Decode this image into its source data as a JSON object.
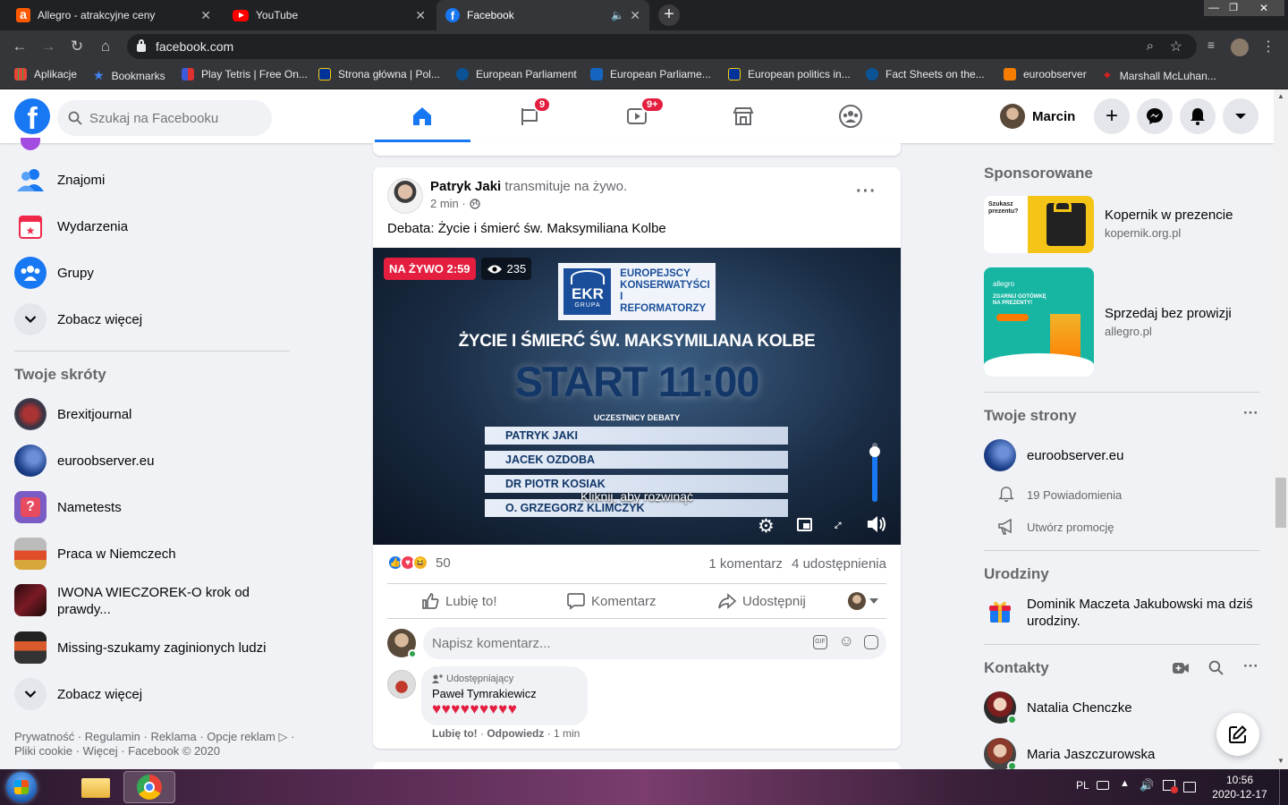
{
  "browser": {
    "tabs": [
      {
        "title": "Allegro - atrakcyjne ceny",
        "icon": "allegro-icon"
      },
      {
        "title": "YouTube",
        "icon": "youtube-icon"
      },
      {
        "title": "Facebook",
        "icon": "facebook-icon"
      }
    ],
    "url": "facebook.com",
    "bookmarks": [
      {
        "label": "Aplikacje",
        "icon": "apps-grid-icon"
      },
      {
        "label": "Bookmarks",
        "icon": "star-icon"
      },
      {
        "label": "Play Tetris | Free On...",
        "icon": "tetris-icon"
      },
      {
        "label": "Strona główna | Pol...",
        "icon": "eu-flag-icon"
      },
      {
        "label": "European Parliament",
        "icon": "eu-parliament-icon"
      },
      {
        "label": "European Parliame...",
        "icon": "eu-parliament-icon"
      },
      {
        "label": "European politics in...",
        "icon": "eu-flag-icon"
      },
      {
        "label": "Fact Sheets on the...",
        "icon": "eu-parliament-icon"
      },
      {
        "label": "euroobserver",
        "icon": "blogger-icon"
      },
      {
        "label": "Marshall McLuhan...",
        "icon": "maple-leaf-icon"
      }
    ]
  },
  "header": {
    "search_placeholder": "Szukaj na Facebooku",
    "badges": {
      "watch": "9",
      "video": "9+"
    },
    "user_name": "Marcin"
  },
  "left": {
    "items": [
      {
        "label": "Znajomi"
      },
      {
        "label": "Wydarzenia"
      },
      {
        "label": "Grupy"
      },
      {
        "label": "Zobacz więcej"
      }
    ],
    "shortcuts_title": "Twoje skróty",
    "shortcuts": [
      {
        "label": "Brexitjournal"
      },
      {
        "label": "euroobserver.eu"
      },
      {
        "label": "Nametests"
      },
      {
        "label": "Praca w Niemczech"
      },
      {
        "label": "IWONA WIECZOREK-O krok od prawdy..."
      },
      {
        "label": "Missing-szukamy zaginionych ludzi"
      },
      {
        "label": "Zobacz więcej"
      }
    ],
    "footer_line1": "Prywatność · Regulamin · Reklama · Opcje reklam ▷ ·",
    "footer_line2": "Pliki cookie · Więcej · Facebook © 2020"
  },
  "post": {
    "author": "Patryk Jaki",
    "action": "transmituje na żywo.",
    "time": "2 min ·",
    "text": "Debata: Życie i śmierć św. Maksymiliana Kolbe",
    "video": {
      "live_label": "NA ŻYWO 2:59",
      "viewers": "235",
      "logo_mark": "EKR",
      "logo_sub": "GRUPA",
      "logo_lines": [
        "EUROPEJSCY",
        "KONSERWATYŚCI",
        "I REFORMATORZY"
      ],
      "headline": "ŻYCIE I ŚMIERĆ ŚW. MAKSYMILIANA KOLBE",
      "start": "START 11:00",
      "participants_label": "UCZESTNICY DEBATY",
      "participants": [
        "PATRYK JAKI",
        "JACEK OZDOBA",
        "DR PIOTR KOSIAK",
        "O. GRZEGORZ KLIMCZYK"
      ],
      "expand_hint": "Kliknij, aby rozwinąć",
      "volume": 0.85
    },
    "reactions_count": "50",
    "comments_count": "1 komentarz",
    "shares_count": "4 udostępnienia",
    "actions": {
      "like": "Lubię to!",
      "comment": "Komentarz",
      "share": "Udostępnij"
    },
    "comment_placeholder": "Napisz komentarz...",
    "comment": {
      "role": "Udostępniający",
      "author": "Paweł Tymrakiewicz",
      "text": "♥♥♥♥♥♥♥♥♥",
      "like": "Lubię to!",
      "reply": "Odpowiedz",
      "time": "1 min"
    }
  },
  "right": {
    "sponsored_title": "Sponsorowane",
    "ads": [
      {
        "title": "Kopernik w prezencie",
        "domain": "kopernik.org.pl"
      },
      {
        "title": "Sprzedaj bez prowizji",
        "domain": "allegro.pl"
      }
    ],
    "pages_title": "Twoje strony",
    "page_name": "euroobserver.eu",
    "notifications": "19 Powiadomienia",
    "promote": "Utwórz promocję",
    "birthdays_title": "Urodziny",
    "birthday_name": "Dominik Maczeta Jakubowski",
    "birthday_text": "ma dziś urodziny.",
    "contacts_title": "Kontakty",
    "contacts": [
      {
        "name": "Natalia Chenczke"
      },
      {
        "name": "Maria Jaszczurowska"
      }
    ]
  },
  "taskbar": {
    "lang": "PL",
    "time": "10:56",
    "date": "2020-12-17"
  },
  "colors": {
    "fb_blue": "#1877f2",
    "live_red": "#e41e3f"
  }
}
